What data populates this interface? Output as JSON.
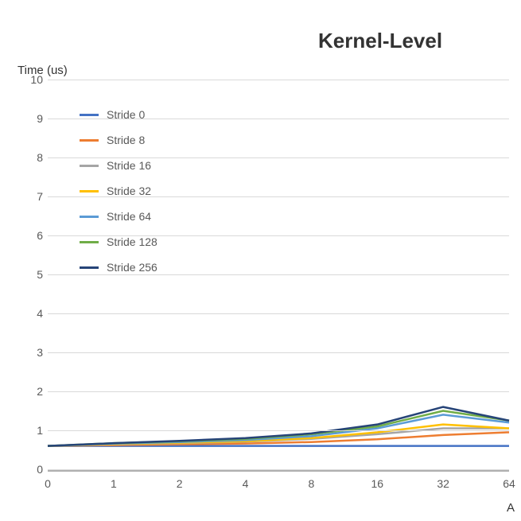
{
  "chart_data": {
    "type": "line",
    "title": "Kernel-Level",
    "ylabel": "Time (us)",
    "xlabel": "A",
    "ylim": [
      0,
      10
    ],
    "yticks": [
      0,
      1,
      2,
      3,
      4,
      5,
      6,
      7,
      8,
      9,
      10
    ],
    "categories": [
      "0",
      "1",
      "2",
      "4",
      "8",
      "16",
      "32",
      "64"
    ],
    "series": [
      {
        "name": "Stride 0",
        "color": "#4472c4",
        "values": [
          0.6,
          0.6,
          0.6,
          0.6,
          0.6,
          0.6,
          0.6,
          0.6
        ]
      },
      {
        "name": "Stride 8",
        "color": "#ed7d31",
        "values": [
          0.6,
          0.62,
          0.64,
          0.66,
          0.7,
          0.77,
          0.88,
          0.95
        ]
      },
      {
        "name": "Stride 16",
        "color": "#a5a5a5",
        "values": [
          0.6,
          0.64,
          0.67,
          0.71,
          0.78,
          0.9,
          1.05,
          1.05
        ]
      },
      {
        "name": "Stride 32",
        "color": "#ffc000",
        "values": [
          0.6,
          0.65,
          0.68,
          0.72,
          0.8,
          0.95,
          1.15,
          1.05
        ]
      },
      {
        "name": "Stride 64",
        "color": "#5b9bd5",
        "values": [
          0.6,
          0.66,
          0.7,
          0.75,
          0.85,
          1.05,
          1.4,
          1.2
        ]
      },
      {
        "name": "Stride 128",
        "color": "#70ad47",
        "values": [
          0.6,
          0.67,
          0.72,
          0.78,
          0.9,
          1.1,
          1.5,
          1.25
        ]
      },
      {
        "name": "Stride 256",
        "color": "#264478",
        "values": [
          0.6,
          0.67,
          0.73,
          0.8,
          0.92,
          1.15,
          1.6,
          1.25
        ]
      }
    ]
  }
}
